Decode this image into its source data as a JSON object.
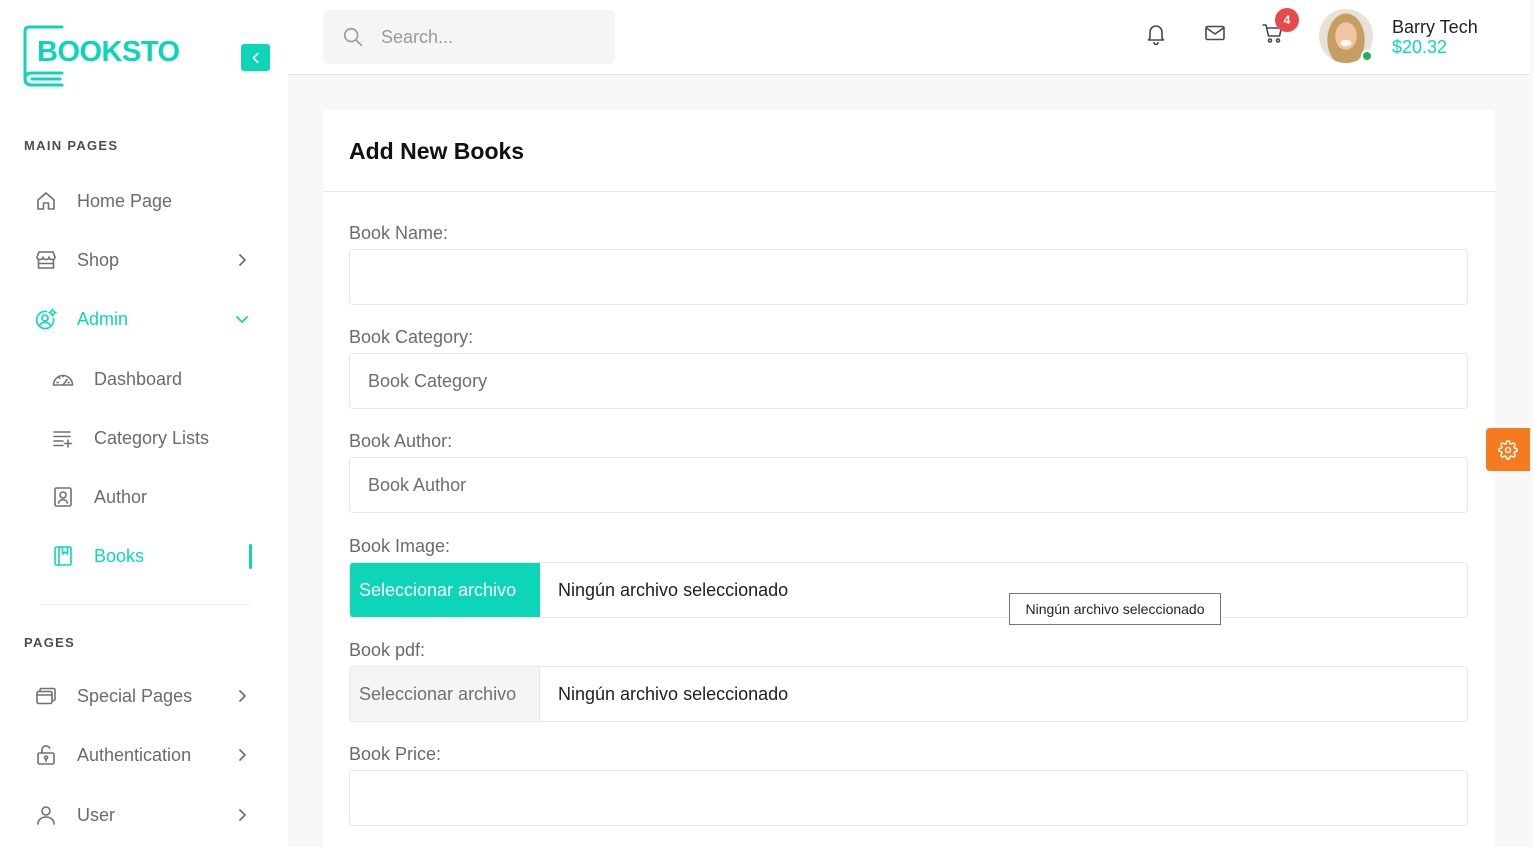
{
  "theme": {
    "accent": "#0dd6b8",
    "settings_button": "#f57c1e",
    "badge": "#e84a4a",
    "online_indicator": "#1fb35a"
  },
  "sidebar": {
    "logo_text": "BOOKSTO",
    "collapse_icon": "chevron-left-icon",
    "main_heading": "MAIN PAGES",
    "main_items": [
      {
        "label": "Home Page",
        "icon": "home-icon"
      },
      {
        "label": "Shop",
        "icon": "store-icon",
        "chevron_icon": "chevron-right-icon"
      },
      {
        "label": "Admin",
        "icon": "user-gear-icon",
        "chevron_icon": "chevron-down-icon",
        "active": true,
        "expanded": true
      }
    ],
    "admin_items": [
      {
        "label": "Dashboard",
        "icon": "gauge-icon"
      },
      {
        "label": "Category Lists",
        "icon": "list-add-icon"
      },
      {
        "label": "Author",
        "icon": "contact-card-icon"
      },
      {
        "label": "Books",
        "icon": "book-icon",
        "active": true
      }
    ],
    "pages_heading": "PAGES",
    "pages_items": [
      {
        "label": "Special Pages",
        "icon": "windows-icon",
        "chevron_icon": "chevron-right-icon"
      },
      {
        "label": "Authentication",
        "icon": "unlock-icon",
        "chevron_icon": "chevron-right-icon"
      },
      {
        "label": "User",
        "icon": "user-icon",
        "chevron_icon": "chevron-right-icon"
      }
    ]
  },
  "header": {
    "search_placeholder": "Search...",
    "search_icon": "search-icon",
    "notifications_icon": "bell-icon",
    "messages_icon": "mail-icon",
    "cart_icon": "cart-icon",
    "cart_count": "4",
    "user": {
      "name": "Barry Tech",
      "balance": "$20.32"
    }
  },
  "form": {
    "title": "Add New Books",
    "fields": {
      "book_name": {
        "label": "Book Name:",
        "value": ""
      },
      "book_category": {
        "label": "Book Category:",
        "placeholder": "Book Category"
      },
      "book_author": {
        "label": "Book Author:",
        "placeholder": "Book Author"
      },
      "book_image": {
        "label": "Book Image:",
        "button_label": "Seleccionar archivo",
        "status": "Ningún archivo seleccionado",
        "tooltip": "Ningún archivo seleccionado"
      },
      "book_pdf": {
        "label": "Book pdf:",
        "button_label": "Seleccionar archivo",
        "status": "Ningún archivo seleccionado"
      },
      "book_price": {
        "label": "Book Price:",
        "value": ""
      }
    }
  },
  "settings_icon": "gear-icon"
}
